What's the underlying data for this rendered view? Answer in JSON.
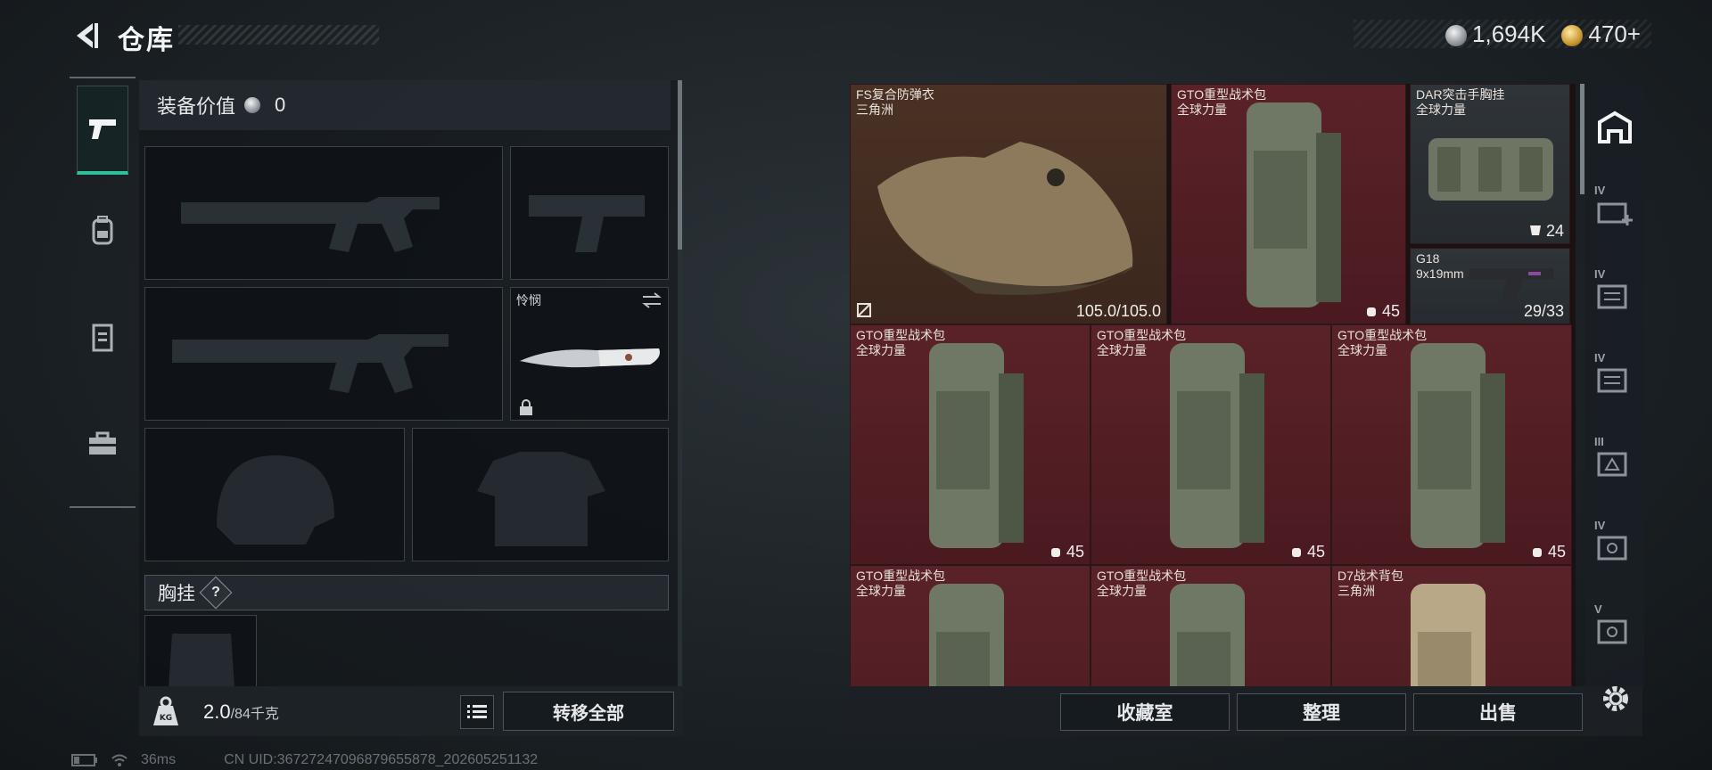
{
  "header": {
    "title": "仓库"
  },
  "currency": {
    "silver": "1,694K",
    "gold": "470+"
  },
  "left_rail": {
    "tabs": [
      {
        "name": "weapons",
        "icon": "pistol-icon",
        "active": true
      },
      {
        "name": "backpack",
        "icon": "backpack-icon",
        "active": false
      },
      {
        "name": "vest",
        "icon": "vest-icon",
        "active": false
      },
      {
        "name": "toolbox",
        "icon": "toolbox-icon",
        "active": false
      }
    ]
  },
  "equipment": {
    "value_label": "装备价值",
    "value": "0",
    "melee_name": "怜悯",
    "chest_rig_label": "胸挂",
    "chest_rig_help": "?"
  },
  "weight": {
    "current": "2.0",
    "capacity": "/84千克"
  },
  "left_actions": {
    "transfer_all": "转移全部"
  },
  "storage": {
    "items": [
      {
        "name": "FS复合防弹衣",
        "origin": "三角洲",
        "count": "105.0/105.0",
        "color": "brown"
      },
      {
        "name": "GTO重型战术包",
        "origin": "全球力量",
        "count": "45",
        "color": "red"
      },
      {
        "name": "DAR突击手胸挂",
        "origin": "全球力量",
        "count": "24",
        "color": "gray"
      },
      {
        "name": "G18",
        "origin": "9x19mm",
        "count": "29/33",
        "color": "gray"
      },
      {
        "name": "GTO重型战术包",
        "origin": "全球力量",
        "count": "45",
        "color": "red"
      },
      {
        "name": "GTO重型战术包",
        "origin": "全球力量",
        "count": "45",
        "color": "red"
      },
      {
        "name": "GTO重型战术包",
        "origin": "全球力量",
        "count": "45",
        "color": "red"
      },
      {
        "name": "GTO重型战术包",
        "origin": "全球力量",
        "count": "",
        "color": "red"
      },
      {
        "name": "GTO重型战术包",
        "origin": "全球力量",
        "count": "",
        "color": "red"
      },
      {
        "name": "D7战术背包",
        "origin": "三角洲",
        "count": "",
        "color": "red"
      }
    ]
  },
  "right_actions": {
    "collection": "收藏室",
    "sort": "整理",
    "sell": "出售"
  },
  "right_rail": {
    "tabs": [
      {
        "label": "",
        "icon": "storage-home-icon"
      },
      {
        "label": "IV",
        "icon": "add-storage-icon"
      },
      {
        "label": "IV",
        "icon": "storage-box-icon"
      },
      {
        "label": "IV",
        "icon": "storage-box-icon"
      },
      {
        "label": "III",
        "icon": "storage-box-icon"
      },
      {
        "label": "IV",
        "icon": "storage-box-icon"
      },
      {
        "label": "V",
        "icon": "storage-box-icon"
      }
    ]
  },
  "status": {
    "ping": "36ms",
    "uid": "CN UID:36727247096879655878_202605251132"
  },
  "colors": {
    "accent": "#2fbf99",
    "item_red": "#5a2228",
    "item_brown": "#4a3124"
  }
}
